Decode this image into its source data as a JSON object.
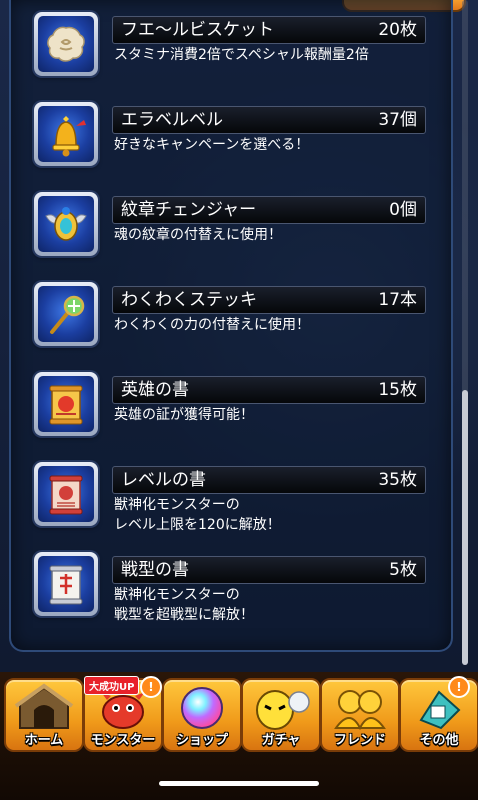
{
  "items": [
    {
      "name": "フエ～ルビスケット",
      "count": "20枚",
      "desc": "スタミナ消費2倍でスペシャル報酬量2倍",
      "icon": "biscuit-icon"
    },
    {
      "name": "エラベルベル",
      "count": "37個",
      "desc": "好きなキャンペーンを選べる！",
      "icon": "bell-icon"
    },
    {
      "name": "紋章チェンジャー",
      "count": "0個",
      "desc": "魂の紋章の付替えに使用！",
      "icon": "emblem-changer-icon"
    },
    {
      "name": "わくわくステッキ",
      "count": "17本",
      "desc": "わくわくの力の付替えに使用！",
      "icon": "wand-icon"
    },
    {
      "name": "英雄の書",
      "count": "15枚",
      "desc": "英雄の証が獲得可能！",
      "icon": "hero-scroll-icon"
    },
    {
      "name": "レベルの書",
      "count": "35枚",
      "desc": "獣神化モンスターの\nレベル上限を120に解放！",
      "icon": "level-scroll-icon"
    },
    {
      "name": "戦型の書",
      "count": "5枚",
      "desc": "獣神化モンスターの\n戦型を超戦型に解放！",
      "icon": "battle-style-scroll-icon"
    }
  ],
  "tabs": [
    {
      "label": "ホーム",
      "icon": "home-icon"
    },
    {
      "label": "モンスター",
      "icon": "monster-icon"
    },
    {
      "label": "ショップ",
      "icon": "orb-icon"
    },
    {
      "label": "ガチャ",
      "icon": "gacha-icon"
    },
    {
      "label": "フレンド",
      "icon": "friend-icon"
    },
    {
      "label": "その他",
      "icon": "other-icon"
    }
  ],
  "promo_badge": "大成功UP",
  "alert_mark": "!",
  "colors": {
    "accent": "#f09a1a",
    "panel": "#0f1b32",
    "name_bar": "#0b0e14"
  }
}
